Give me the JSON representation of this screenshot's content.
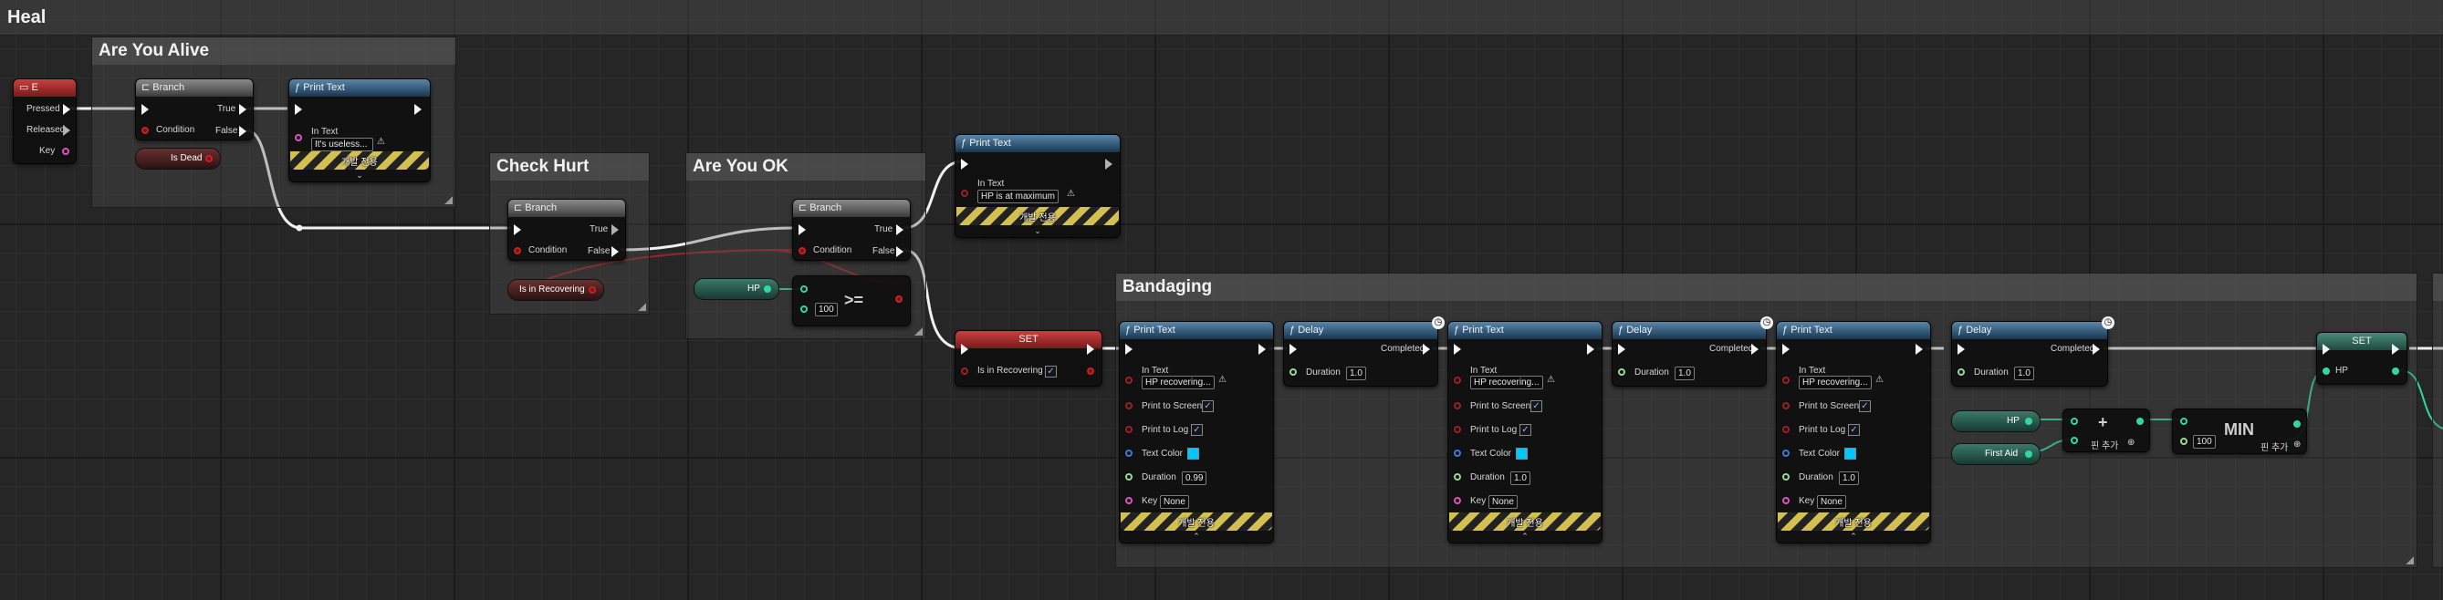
{
  "graph_title": "Heal",
  "comments": {
    "are_you_alive": "Are You Alive",
    "check_hurt": "Check Hurt",
    "are_you_ok": "Are You OK",
    "bandaging": "Bandaging"
  },
  "key_event": {
    "title": "E",
    "pressed": "Pressed",
    "released": "Released",
    "key": "Key"
  },
  "branch_1": {
    "title": "Branch",
    "condition": "Condition",
    "true": "True",
    "false": "False"
  },
  "branch_2": {
    "title": "Branch",
    "condition": "Condition",
    "true": "True",
    "false": "False"
  },
  "branch_3": {
    "title": "Branch",
    "condition": "Condition",
    "true": "True",
    "false": "False"
  },
  "print_useless": {
    "title": "Print Text",
    "in_text_label": "In Text",
    "in_text": "It's useless...",
    "dev_only": "개발 전용"
  },
  "print_max": {
    "title": "Print Text",
    "in_text_label": "In Text",
    "in_text": "HP is at maximum",
    "dev_only": "개발 전용"
  },
  "is_dead": "Is Dead",
  "is_in_recovering": "Is in Recovering",
  "hp_getter": "HP",
  "compare": {
    "op": ">=",
    "value": "100"
  },
  "set_recovering": {
    "title": "SET",
    "label": "Is in Recovering"
  },
  "print_recover_1": {
    "title": "Print Text",
    "in_text_label": "In Text",
    "in_text": "HP recovering...",
    "print_to_screen": "Print to Screen",
    "print_to_log": "Print to Log",
    "text_color": "Text Color",
    "duration_label": "Duration",
    "duration": "0.99",
    "key_label": "Key",
    "key": "None",
    "dev_only": "개발 전용"
  },
  "print_recover_2": {
    "title": "Print Text",
    "in_text_label": "In Text",
    "in_text": "HP recovering...",
    "print_to_screen": "Print to Screen",
    "print_to_log": "Print to Log",
    "text_color": "Text Color",
    "duration_label": "Duration",
    "duration": "1.0",
    "key_label": "Key",
    "key": "None",
    "dev_only": "개발 전용"
  },
  "print_recover_3": {
    "title": "Print Text",
    "in_text_label": "In Text",
    "in_text": "HP recovering...",
    "print_to_screen": "Print to Screen",
    "print_to_log": "Print to Log",
    "text_color": "Text Color",
    "duration_label": "Duration",
    "duration": "1.0",
    "key_label": "Key",
    "key": "None",
    "dev_only": "개발 전용"
  },
  "delay_1": {
    "title": "Delay",
    "completed": "Completed",
    "duration_label": "Duration",
    "duration": "1.0"
  },
  "delay_2": {
    "title": "Delay",
    "completed": "Completed",
    "duration_label": "Duration",
    "duration": "1.0"
  },
  "delay_3": {
    "title": "Delay",
    "completed": "Completed",
    "duration_label": "Duration",
    "duration": "1.0"
  },
  "hp_getter_2": "HP",
  "first_aid": "First Aid",
  "add": {
    "op": "+",
    "add_pin": "핀 추가"
  },
  "min": {
    "op": "MIN",
    "value": "100",
    "add_pin": "핀 추가"
  },
  "set_hp": {
    "title": "SET",
    "label": "HP"
  },
  "colors": {
    "exec": "#f4f4f4",
    "bool": "#c02424",
    "float": "#2fd9a0",
    "function_header": "#2a4f6e"
  }
}
